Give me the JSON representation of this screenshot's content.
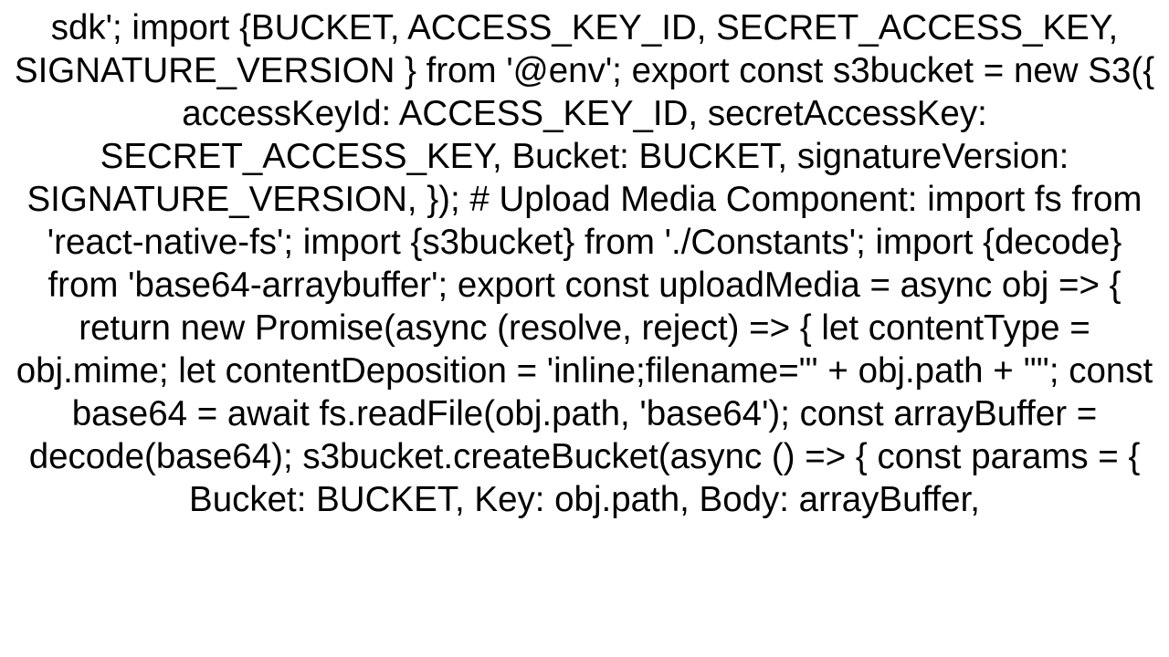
{
  "code": {
    "text": "sdk'; import {BUCKET, ACCESS_KEY_ID, SECRET_ACCESS_KEY, SIGNATURE_VERSION } from '@env';  export const s3bucket = new S3({   accessKeyId: ACCESS_KEY_ID,   secretAccessKey: SECRET_ACCESS_KEY,   Bucket: BUCKET,   signatureVersion: SIGNATURE_VERSION, });  # Upload Media Component: import fs from 'react-native-fs'; import {s3bucket} from './Constants'; import {decode} from 'base64-arraybuffer';  export const uploadMedia = async obj => {   return new Promise(async (resolve, reject) => {     let contentType = obj.mime;     let contentDeposition = 'inline;filename=\"' + obj.path + '\"';     const base64 = await fs.readFile(obj.path, 'base64');     const arrayBuffer = decode(base64);     s3bucket.createBucket(async () => {       const params = {         Bucket: BUCKET,         Key: obj.path,         Body: arrayBuffer,"
  }
}
